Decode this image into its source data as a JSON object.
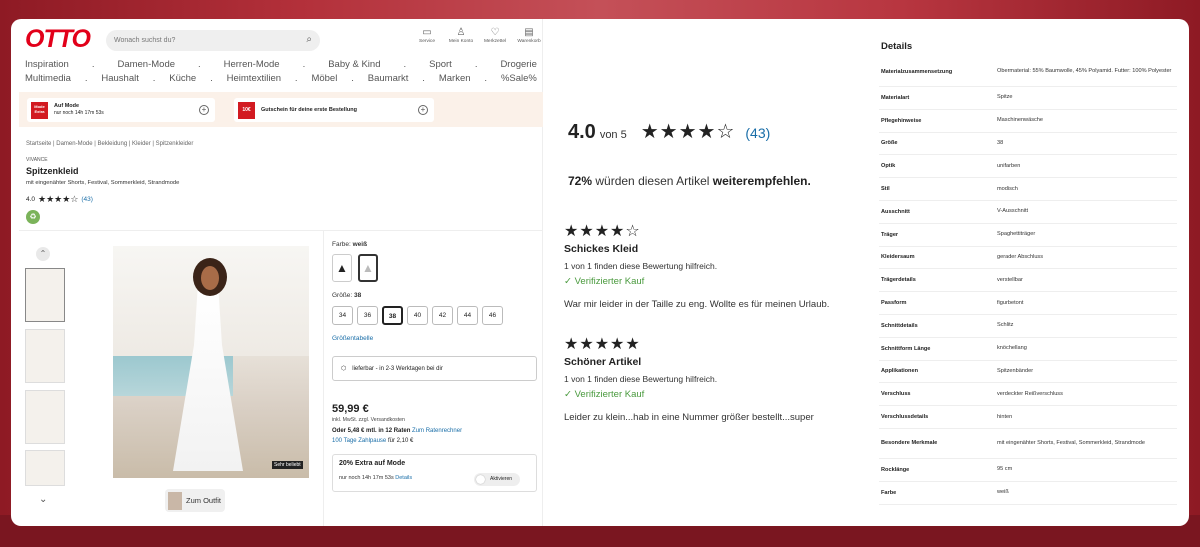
{
  "header": {
    "logo": "OTTO",
    "search_placeholder": "Wonach suchst du?",
    "icons": [
      {
        "icon": "service-icon",
        "label": "Service"
      },
      {
        "icon": "user-icon",
        "label": "Mein Konto"
      },
      {
        "icon": "heart-icon",
        "label": "Merkzettel"
      },
      {
        "icon": "cart-icon",
        "label": "Warenkorb"
      }
    ]
  },
  "nav": {
    "row1": [
      "Inspiration",
      ".",
      "Damen-Mode",
      ".",
      "Herren-Mode",
      ".",
      "Baby & Kind",
      ".",
      "Sport",
      ".",
      "Drogerie"
    ],
    "row2": [
      "Multimedia",
      ".",
      "Haushalt",
      ".",
      "Küche",
      ".",
      "Heimtextilien",
      ".",
      "Möbel",
      ".",
      "Baumarkt",
      ".",
      "Marken",
      ".",
      "%Sale%"
    ]
  },
  "promos": [
    {
      "badge": "Mode Extra",
      "title": "Auf Mode",
      "sub": "nur noch 14h 17m 53s"
    },
    {
      "badge": "10€",
      "title": "Gutschein für deine erste Bestellung",
      "sub": ""
    }
  ],
  "breadcrumb": "Startseite | Damen-Mode | Bekleidung | Kleider | Spitzenkleider",
  "product": {
    "brand": "VIVANCE",
    "title": "Spitzenkleid",
    "subtitle": "mit eingenähter Shorts, Festival, Sommerkleid, Strandmode",
    "rating": "4.0",
    "stars": "★★★★☆",
    "review_count": "(43)",
    "image_badge": "Sehr beliebt",
    "outfit_label": "Zum Outfit"
  },
  "options": {
    "color_label": "Farbe:",
    "color_value": "weiß",
    "size_label": "Größe:",
    "size_value": "38",
    "sizes": [
      "34",
      "36",
      "38",
      "40",
      "42",
      "44",
      "46"
    ],
    "selected_size": "38",
    "size_table_link": "Größentabelle",
    "delivery": "lieferbar - in 2-3 Werktagen bei dir"
  },
  "pricing": {
    "price": "59,99 €",
    "tax_note": "inkl. MwSt. zzgl. Versandkosten",
    "installment": "Oder 5,48 € mtl. in 12 Raten",
    "installment_link": "Zum Ratenrechner",
    "pause_link": "100 Tage Zahlpause",
    "pause_price": "für 2,10 €"
  },
  "extra": {
    "title": "20% Extra auf Mode",
    "timer": "nur noch 14h 17m 53s",
    "details_link": "Details",
    "toggle_label": "Aktivieren"
  },
  "reviews_summary": {
    "score": "4.0",
    "of": "von 5",
    "stars": "★★★★☆",
    "count": "(43)",
    "recommend_pct": "72%",
    "recommend_mid": "würden diesen Artikel",
    "recommend_end": "weiterempfehlen."
  },
  "reviews": [
    {
      "stars": "★★★★☆",
      "title": "Schickes Kleid",
      "helpful": "1 von 1 finden diese Bewertung hilfreich.",
      "verified": "✓ Verifizierter Kauf",
      "text": "War mir leider in der Taille zu eng. Wollte es für meinen Urlaub."
    },
    {
      "stars": "★★★★★",
      "title": "Schöner Artikel",
      "helpful": "1 von 1 finden diese Bewertung hilfreich.",
      "verified": "✓ Verifizierter Kauf",
      "text": "Leider zu klein...hab in eine Nummer größer bestellt...super"
    }
  ],
  "details": {
    "title": "Details",
    "rows": [
      {
        "k": "Materialzusammensetzung",
        "v": "Obermaterial: 55% Baumwolle, 45% Polyamid. Futter: 100% Polyester"
      },
      {
        "k": "Materialart",
        "v": "Spitze"
      },
      {
        "k": "Pflegehinweise",
        "v": "Maschinenwäsche"
      },
      {
        "k": "Größe",
        "v": "38"
      },
      {
        "k": "Optik",
        "v": "unifarben"
      },
      {
        "k": "Stil",
        "v": "modisch"
      },
      {
        "k": "Ausschnitt",
        "v": "V-Ausschnitt"
      },
      {
        "k": "Träger",
        "v": "Spaghettiträger"
      },
      {
        "k": "Kleidersaum",
        "v": "gerader Abschluss"
      },
      {
        "k": "Trägerdetails",
        "v": "verstellbar"
      },
      {
        "k": "Passform",
        "v": "figurbetont"
      },
      {
        "k": "Schnittdetails",
        "v": "Schlitz"
      },
      {
        "k": "Schnittform Länge",
        "v": "knöchellang"
      },
      {
        "k": "Applikationen",
        "v": "Spitzenbänder"
      },
      {
        "k": "Verschluss",
        "v": "verdeckter Reißverschluss"
      },
      {
        "k": "Verschlussdetails",
        "v": "hinten"
      },
      {
        "k": "Besondere Merkmale",
        "v": "mit eingenähter Shorts, Festival, Sommerkleid, Strandmode"
      },
      {
        "k": "Rocklänge",
        "v": "95 cm"
      },
      {
        "k": "Farbe",
        "v": "weiß"
      }
    ]
  }
}
